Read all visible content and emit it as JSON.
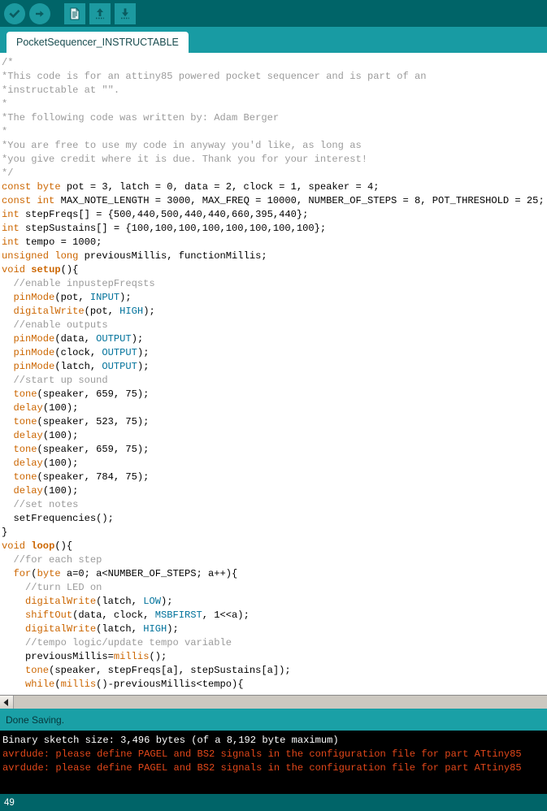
{
  "toolbar": {
    "buttons": [
      {
        "name": "verify-button",
        "icon": "checkmark-circle-icon",
        "title": "Verify"
      },
      {
        "name": "upload-button",
        "icon": "arrow-right-circle-icon",
        "title": "Upload"
      },
      {
        "name": "new-sketch-button",
        "icon": "new-file-icon",
        "title": "New"
      },
      {
        "name": "open-sketch-button",
        "icon": "arrow-up-icon",
        "title": "Open"
      },
      {
        "name": "save-sketch-button",
        "icon": "arrow-down-icon",
        "title": "Save"
      }
    ]
  },
  "tabs": [
    {
      "label": "PocketSequencer_INSTRUCTABLE",
      "active": true
    }
  ],
  "editor": {
    "lines": [
      [
        {
          "t": "/*",
          "c": "cmt"
        }
      ],
      [
        {
          "t": "*This code is for an attiny85 powered pocket sequencer and is part of an",
          "c": "cmt"
        }
      ],
      [
        {
          "t": "*instructable at \"\".",
          "c": "cmt"
        }
      ],
      [
        {
          "t": "*",
          "c": "cmt"
        }
      ],
      [
        {
          "t": "*The following code was written by: Adam Berger",
          "c": "cmt"
        }
      ],
      [
        {
          "t": "*",
          "c": "cmt"
        }
      ],
      [
        {
          "t": "*You are free to use my code in anyway you'd like, as long as",
          "c": "cmt"
        }
      ],
      [
        {
          "t": "*you give credit where it is due. Thank you for your interest!",
          "c": "cmt"
        }
      ],
      [
        {
          "t": "*/",
          "c": "cmt"
        }
      ],
      [
        {
          "t": "const byte",
          "c": "kw"
        },
        {
          "t": " pot = 3, latch = 0, data = 2, clock = 1, speaker = 4;",
          "c": ""
        }
      ],
      [
        {
          "t": "const int",
          "c": "kw"
        },
        {
          "t": " MAX_NOTE_LENGTH = 3000, MAX_FREQ = 10000, NUMBER_OF_STEPS = 8, POT_THRESHOLD = 25;",
          "c": ""
        }
      ],
      [
        {
          "t": "int",
          "c": "kw"
        },
        {
          "t": " stepFreqs[] = {500,440,500,440,440,660,395,440};",
          "c": ""
        }
      ],
      [
        {
          "t": "int",
          "c": "kw"
        },
        {
          "t": " stepSustains[] = {100,100,100,100,100,100,100,100};",
          "c": ""
        }
      ],
      [
        {
          "t": "int",
          "c": "kw"
        },
        {
          "t": " tempo = 1000;",
          "c": ""
        }
      ],
      [
        {
          "t": "unsigned long",
          "c": "kw"
        },
        {
          "t": " previousMillis, functionMillis;",
          "c": ""
        }
      ],
      [
        {
          "t": "void ",
          "c": "kw"
        },
        {
          "t": "setup",
          "c": "fnb"
        },
        {
          "t": "(){",
          "c": ""
        }
      ],
      [
        {
          "t": "  //enable inpustepFreqsts",
          "c": "cmt"
        }
      ],
      [
        {
          "t": "  ",
          "c": ""
        },
        {
          "t": "pinMode",
          "c": "fn"
        },
        {
          "t": "(pot, ",
          "c": ""
        },
        {
          "t": "INPUT",
          "c": "cst"
        },
        {
          "t": ");",
          "c": ""
        }
      ],
      [
        {
          "t": "  ",
          "c": ""
        },
        {
          "t": "digitalWrite",
          "c": "fn"
        },
        {
          "t": "(pot, ",
          "c": ""
        },
        {
          "t": "HIGH",
          "c": "cst"
        },
        {
          "t": ");",
          "c": ""
        }
      ],
      [
        {
          "t": "  //enable outputs",
          "c": "cmt"
        }
      ],
      [
        {
          "t": "  ",
          "c": ""
        },
        {
          "t": "pinMode",
          "c": "fn"
        },
        {
          "t": "(data, ",
          "c": ""
        },
        {
          "t": "OUTPUT",
          "c": "cst"
        },
        {
          "t": ");",
          "c": ""
        }
      ],
      [
        {
          "t": "  ",
          "c": ""
        },
        {
          "t": "pinMode",
          "c": "fn"
        },
        {
          "t": "(clock, ",
          "c": ""
        },
        {
          "t": "OUTPUT",
          "c": "cst"
        },
        {
          "t": ");",
          "c": ""
        }
      ],
      [
        {
          "t": "  ",
          "c": ""
        },
        {
          "t": "pinMode",
          "c": "fn"
        },
        {
          "t": "(latch, ",
          "c": ""
        },
        {
          "t": "OUTPUT",
          "c": "cst"
        },
        {
          "t": ");",
          "c": ""
        }
      ],
      [
        {
          "t": "  //start up sound",
          "c": "cmt"
        }
      ],
      [
        {
          "t": "  ",
          "c": ""
        },
        {
          "t": "tone",
          "c": "fn"
        },
        {
          "t": "(speaker, 659, 75);",
          "c": ""
        }
      ],
      [
        {
          "t": "  ",
          "c": ""
        },
        {
          "t": "delay",
          "c": "fn"
        },
        {
          "t": "(100);",
          "c": ""
        }
      ],
      [
        {
          "t": "  ",
          "c": ""
        },
        {
          "t": "tone",
          "c": "fn"
        },
        {
          "t": "(speaker, 523, 75);",
          "c": ""
        }
      ],
      [
        {
          "t": "  ",
          "c": ""
        },
        {
          "t": "delay",
          "c": "fn"
        },
        {
          "t": "(100);",
          "c": ""
        }
      ],
      [
        {
          "t": "  ",
          "c": ""
        },
        {
          "t": "tone",
          "c": "fn"
        },
        {
          "t": "(speaker, 659, 75);",
          "c": ""
        }
      ],
      [
        {
          "t": "  ",
          "c": ""
        },
        {
          "t": "delay",
          "c": "fn"
        },
        {
          "t": "(100);",
          "c": ""
        }
      ],
      [
        {
          "t": "  ",
          "c": ""
        },
        {
          "t": "tone",
          "c": "fn"
        },
        {
          "t": "(speaker, 784, 75);",
          "c": ""
        }
      ],
      [
        {
          "t": "  ",
          "c": ""
        },
        {
          "t": "delay",
          "c": "fn"
        },
        {
          "t": "(100);",
          "c": ""
        }
      ],
      [
        {
          "t": "  //set notes",
          "c": "cmt"
        }
      ],
      [
        {
          "t": "  setFrequencies();",
          "c": ""
        }
      ],
      [
        {
          "t": "}",
          "c": ""
        }
      ],
      [
        {
          "t": "void ",
          "c": "kw"
        },
        {
          "t": "loop",
          "c": "fnb"
        },
        {
          "t": "(){",
          "c": ""
        }
      ],
      [
        {
          "t": "  //for each step",
          "c": "cmt"
        }
      ],
      [
        {
          "t": "  ",
          "c": ""
        },
        {
          "t": "for",
          "c": "kw"
        },
        {
          "t": "(",
          "c": ""
        },
        {
          "t": "byte",
          "c": "kw"
        },
        {
          "t": " a=0; a<NUMBER_OF_STEPS; a++){",
          "c": ""
        }
      ],
      [
        {
          "t": "    //turn LED on",
          "c": "cmt"
        }
      ],
      [
        {
          "t": "    ",
          "c": ""
        },
        {
          "t": "digitalWrite",
          "c": "fn"
        },
        {
          "t": "(latch, ",
          "c": ""
        },
        {
          "t": "LOW",
          "c": "cst"
        },
        {
          "t": ");",
          "c": ""
        }
      ],
      [
        {
          "t": "    ",
          "c": ""
        },
        {
          "t": "shiftOut",
          "c": "fn"
        },
        {
          "t": "(data, clock, ",
          "c": ""
        },
        {
          "t": "MSBFIRST",
          "c": "cst"
        },
        {
          "t": ", 1<<a);",
          "c": ""
        }
      ],
      [
        {
          "t": "    ",
          "c": ""
        },
        {
          "t": "digitalWrite",
          "c": "fn"
        },
        {
          "t": "(latch, ",
          "c": ""
        },
        {
          "t": "HIGH",
          "c": "cst"
        },
        {
          "t": ");",
          "c": ""
        }
      ],
      [
        {
          "t": "    //tempo logic/update tempo variable",
          "c": "cmt"
        }
      ],
      [
        {
          "t": "    previousMillis=",
          "c": ""
        },
        {
          "t": "millis",
          "c": "fn"
        },
        {
          "t": "();",
          "c": ""
        }
      ],
      [
        {
          "t": "    ",
          "c": ""
        },
        {
          "t": "tone",
          "c": "fn"
        },
        {
          "t": "(speaker, stepFreqs[a], stepSustains[a]);",
          "c": ""
        }
      ],
      [
        {
          "t": "    ",
          "c": ""
        },
        {
          "t": "while",
          "c": "kw"
        },
        {
          "t": "(",
          "c": ""
        },
        {
          "t": "millis",
          "c": "fn"
        },
        {
          "t": "()-previousMillis<tempo){",
          "c": ""
        }
      ]
    ]
  },
  "scrollbar": {
    "left_arrow_icon": "triangle-left-icon"
  },
  "status": {
    "message": "Done Saving."
  },
  "console": {
    "lines": [
      {
        "text": "Binary sketch size: 3,496 bytes (of a 8,192 byte maximum)",
        "level": "out"
      },
      {
        "text": "avrdude: please define PAGEL and BS2 signals in the configuration file for part ATtiny85",
        "level": "err"
      },
      {
        "text": "avrdude: please define PAGEL and BS2 signals in the configuration file for part ATtiny85",
        "level": "err"
      }
    ]
  },
  "footer": {
    "line_number": "49"
  },
  "colors": {
    "teal_dark": "#006468",
    "teal_light": "#1AA0A6",
    "tabbar": "#189BA3",
    "keyword": "#CC6600",
    "comment": "#9B9B9B",
    "constant": "#00729B",
    "console_bg": "#000000",
    "console_err": "#E2471A",
    "console_out": "#FFFFFF"
  }
}
